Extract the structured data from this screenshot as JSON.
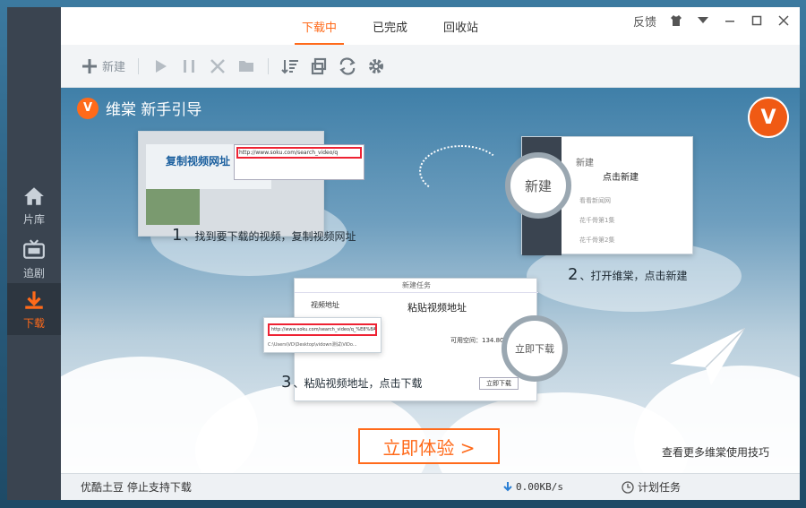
{
  "leftnav": {
    "items": [
      {
        "label": "片库",
        "icon": "home-icon"
      },
      {
        "label": "追剧",
        "icon": "tv-icon"
      },
      {
        "label": "下载",
        "icon": "download-icon"
      }
    ],
    "active_index": 2
  },
  "tabs": [
    {
      "label": "下载中",
      "active": true
    },
    {
      "label": "已完成",
      "active": false
    },
    {
      "label": "回收站",
      "active": false
    }
  ],
  "window_controls": {
    "feedback": "反馈",
    "icons": [
      "shirt-icon",
      "menu-down-icon",
      "minimize-icon",
      "maximize-icon",
      "close-icon"
    ]
  },
  "toolbar": {
    "new_label": "新建",
    "buttons": [
      "play-icon",
      "pause-icon",
      "delete-icon",
      "folder-icon",
      "sort-icon",
      "copy-icon",
      "refresh-icon",
      "settings-icon"
    ]
  },
  "guide": {
    "title": "维棠 新手引导",
    "step1": {
      "num": "1",
      "text": "、找到要下载的视频，复制视频网址"
    },
    "step2": {
      "num": "2",
      "text": "、打开维棠，点击新建"
    },
    "step3": {
      "num": "3",
      "text": "、粘贴视频地址，点击下载"
    },
    "shot1_caption": "复制视频网址",
    "shot1_url": "http://www.soku.com/search_video/q",
    "shot2_new": "新建",
    "shot2_click": "点击新建",
    "shot2_rows": [
      "看看新闻网 ",
      "花千骨第1集 ",
      "花千骨第2集 "
    ],
    "shot3_title": "新建任务",
    "shot3_label": "视频地址",
    "shot3_paste": "粘贴视频地址",
    "shot3_url": "http://www.soku.com/search_video/q_%E8%8A%B1%E5%8D%83%E9%AA%A8",
    "shot3_path": "C:\\Users\\VD\\Desktop\\vidown测试\\ViDo...",
    "shot3_space": "可用空间：134.8G",
    "shot3_download": "立即下载",
    "circle_new": "新建",
    "circle_download": "立即下载",
    "cta": "立即体验 >",
    "tip": "查看更多维棠使用技巧"
  },
  "status": {
    "left_text": "优酷土豆 停止支持下载",
    "speed": "0.00KB/s",
    "schedule": "计划任务"
  },
  "colors": {
    "accent": "#ff6a1a",
    "nav_bg": "#3a4450"
  }
}
